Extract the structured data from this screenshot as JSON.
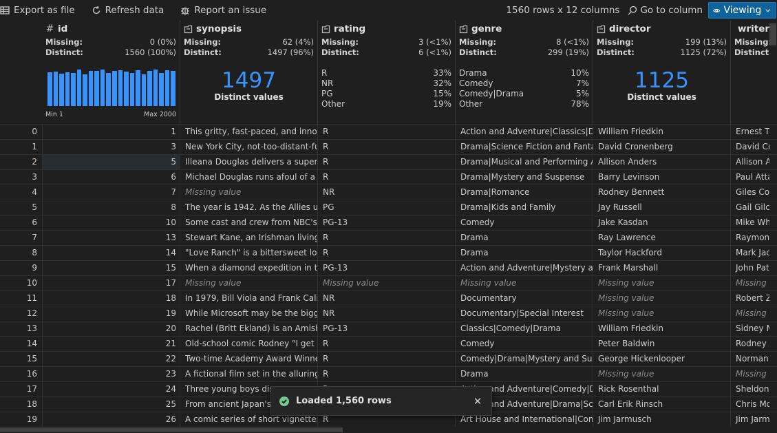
{
  "toolbar": {
    "export_label": "Export as file",
    "refresh_label": "Refresh data",
    "report_label": "Report an issue",
    "row_count": "1560 rows x 12 columns",
    "goto_label": "Go to column",
    "viewing_label": "Viewing"
  },
  "columns": {
    "id": {
      "name": "id",
      "type_icon": "#",
      "missing_label": "Missing:",
      "missing": "0 (0%)",
      "distinct_label": "Distinct:",
      "distinct": "1560 (100%)",
      "hist_min": "Min 1",
      "hist_max": "Max 2000",
      "histogram": [
        0.92,
        0.94,
        0.88,
        0.92,
        0.9,
        1.0,
        0.86,
        0.96,
        0.96,
        1.0,
        0.9,
        0.96,
        0.98,
        0.94,
        0.9,
        0.98,
        0.86,
        0.96,
        1.0,
        0.9,
        0.98,
        0.96
      ]
    },
    "synopsis": {
      "name": "synopsis",
      "missing_label": "Missing:",
      "missing": "62 (4%)",
      "distinct_label": "Distinct:",
      "distinct": "1497 (96%)",
      "big_number": "1497",
      "big_label": "Distinct values"
    },
    "rating": {
      "name": "rating",
      "missing_label": "Missing:",
      "missing": "3 (<1%)",
      "distinct_label": "Distinct:",
      "distinct": "6 (<1%)",
      "top": [
        {
          "label": "R",
          "pct": "33%"
        },
        {
          "label": "NR",
          "pct": "32%"
        },
        {
          "label": "PG",
          "pct": "15%"
        },
        {
          "label": "Other",
          "pct": "19%"
        }
      ]
    },
    "genre": {
      "name": "genre",
      "missing_label": "Missing:",
      "missing": "8 (<1%)",
      "distinct_label": "Distinct:",
      "distinct": "299 (19%)",
      "top": [
        {
          "label": "Drama",
          "pct": "10%"
        },
        {
          "label": "Comedy",
          "pct": "7%"
        },
        {
          "label": "Comedy|Drama",
          "pct": "5%"
        },
        {
          "label": "Other",
          "pct": "78%"
        }
      ]
    },
    "director": {
      "name": "director",
      "missing_label": "Missing:",
      "missing": "199 (13%)",
      "distinct_label": "Distinct:",
      "distinct": "1125 (72%)",
      "big_number": "1125",
      "big_label": "Distinct values"
    },
    "writer": {
      "name": "writer",
      "missing_label": "Missing:",
      "distinct_label": "Distinct:"
    }
  },
  "missing_text": "Missing value",
  "rows": [
    {
      "idx": "0",
      "id": "1",
      "synopsis": "This gritty, fast-paced, and innovative police drama",
      "rating": "R",
      "genre": "Action and Adventure|Classics|Drama",
      "director": "William Friedkin",
      "writer": "Ernest Tidyman"
    },
    {
      "idx": "1",
      "id": "3",
      "synopsis": "New York City, not-too-distant-future",
      "rating": "R",
      "genre": "Drama|Science Fiction and Fantasy",
      "director": "David Cronenberg",
      "writer": "David Cronenberg"
    },
    {
      "idx": "2",
      "id": "5",
      "synopsis": "Illeana Douglas delivers a superb performance",
      "rating": "R",
      "genre": "Drama|Musical and Performing Arts",
      "director": "Allison Anders",
      "writer": "Allison Anders"
    },
    {
      "idx": "3",
      "id": "6",
      "synopsis": "Michael Douglas runs afoul of a treacherous",
      "rating": "R",
      "genre": "Drama|Mystery and Suspense",
      "director": "Barry Levinson",
      "writer": "Paul Attanasio"
    },
    {
      "idx": "4",
      "id": "7",
      "synopsis": null,
      "rating": "NR",
      "genre": "Drama|Romance",
      "director": "Rodney Bennett",
      "writer": "Giles Cooper"
    },
    {
      "idx": "5",
      "id": "8",
      "synopsis": "The year is 1942. As the Allies unite",
      "rating": "PG",
      "genre": "Drama|Kids and Family",
      "director": "Jay Russell",
      "writer": "Gail Gilchriest"
    },
    {
      "idx": "6",
      "id": "10",
      "synopsis": "Some cast and crew from NBC's highly",
      "rating": "PG-13",
      "genre": "Comedy",
      "director": "Jake Kasdan",
      "writer": "Mike White"
    },
    {
      "idx": "7",
      "id": "13",
      "synopsis": "Stewart Kane, an Irishman living in the",
      "rating": "R",
      "genre": "Drama",
      "director": "Ray Lawrence",
      "writer": "Raymond Carver"
    },
    {
      "idx": "8",
      "id": "14",
      "synopsis": "\"Love Ranch\" is a bittersweet love story",
      "rating": "R",
      "genre": "Drama",
      "director": "Taylor Hackford",
      "writer": "Mark Jacobson"
    },
    {
      "idx": "9",
      "id": "15",
      "synopsis": "When a diamond expedition in the Congo",
      "rating": "PG-13",
      "genre": "Action and Adventure|Mystery and Suspense",
      "director": "Frank Marshall",
      "writer": "John Patrick Shanley"
    },
    {
      "idx": "10",
      "id": "17",
      "synopsis": null,
      "rating": null,
      "genre": null,
      "director": null,
      "writer": null
    },
    {
      "idx": "11",
      "id": "18",
      "synopsis": "In 1979, Bill Viola and Frank Caliguri",
      "rating": "NR",
      "genre": "Documentary",
      "director": null,
      "writer": "Robert Zagone"
    },
    {
      "idx": "12",
      "id": "19",
      "synopsis": "While Microsoft may be the biggest",
      "rating": "NR",
      "genre": "Documentary|Special Interest",
      "director": null,
      "writer": null
    },
    {
      "idx": "13",
      "id": "20",
      "synopsis": "Rachel (Britt Ekland) is an Amish girl",
      "rating": "PG-13",
      "genre": "Classics|Comedy|Drama",
      "director": "William Friedkin",
      "writer": "Sidney Michaels"
    },
    {
      "idx": "14",
      "id": "21",
      "synopsis": "Old-school comic Rodney \"I get no respect\"",
      "rating": "R",
      "genre": "Comedy",
      "director": "Peter Baldwin",
      "writer": "Rodney Dangerfield"
    },
    {
      "idx": "15",
      "id": "22",
      "synopsis": "Two-time Academy Award Winner Kevin",
      "rating": "R",
      "genre": "Comedy|Drama|Mystery and Suspense",
      "director": "George Hickenlooper",
      "writer": "Norman Snider"
    },
    {
      "idx": "16",
      "id": "23",
      "synopsis": "A fictional film set in the alluring world",
      "rating": "R",
      "genre": "Drama",
      "director": null,
      "writer": null
    },
    {
      "idx": "17",
      "id": "24",
      "synopsis": "Three young boys discover",
      "rating": "R",
      "genre": "Action and Adventure|Comedy|Drama",
      "director": "Rick Rosenthal",
      "writer": "Sheldon Lettich"
    },
    {
      "idx": "18",
      "id": "25",
      "synopsis": "From ancient Japan's most",
      "rating": "R",
      "genre": "Action and Adventure|Drama|Science Fiction",
      "director": "Carl Erik Rinsch",
      "writer": "Chris Morgan"
    },
    {
      "idx": "19",
      "id": "26",
      "synopsis": "A comic series of short vignettes built",
      "rating": "R",
      "genre": "Art House and International|Comedy",
      "director": "Jim Jarmusch",
      "writer": "Jim Jarmusch"
    }
  ],
  "toast": {
    "text": "Loaded 1,560 rows"
  }
}
